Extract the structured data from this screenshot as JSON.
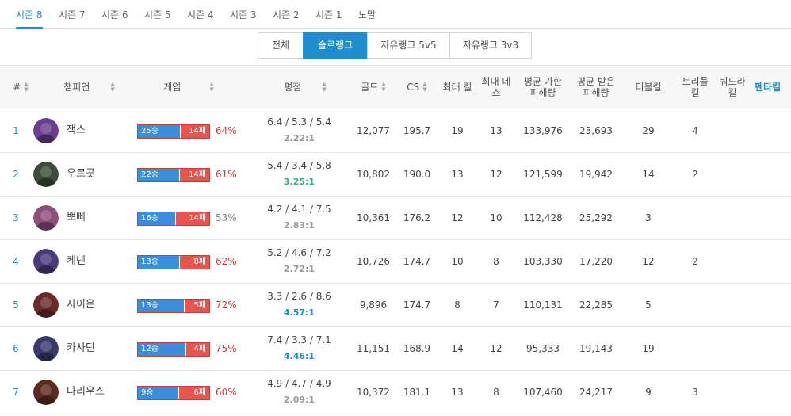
{
  "season_tabs": [
    {
      "label": "시즌 8",
      "active": true
    },
    {
      "label": "시즌 7",
      "active": false
    },
    {
      "label": "시즌 6",
      "active": false
    },
    {
      "label": "시즌 5",
      "active": false
    },
    {
      "label": "시즌 4",
      "active": false
    },
    {
      "label": "시즌 3",
      "active": false
    },
    {
      "label": "시즌 2",
      "active": false
    },
    {
      "label": "시즌 1",
      "active": false
    },
    {
      "label": "노말",
      "active": false
    }
  ],
  "queue_tabs": [
    {
      "label": "전체",
      "active": false
    },
    {
      "label": "솔로랭크",
      "active": true
    },
    {
      "label": "자유랭크 5v5",
      "active": false
    },
    {
      "label": "자유랭크 3v3",
      "active": false
    }
  ],
  "columns": {
    "rank": "#",
    "champion": "챔피언",
    "games": "게임",
    "rating": "평점",
    "gold": "골드",
    "cs": "CS",
    "max_kills": "최대 킬",
    "max_deaths": "최대 데스",
    "dmg_dealt": "평균 가한 피해량",
    "dmg_taken": "평균 받은 피해량",
    "double": "더블킬",
    "triple": "트리플킬",
    "quadra": "쿼드라킬",
    "penta": "펜타킬"
  },
  "colors": {
    "accent": "#1f8ecd",
    "win": "#3b8ed9",
    "loss": "#e8544e",
    "winrate_high": "#d0393a",
    "winrate_mid": "#888888",
    "ratio_normal": "#999999",
    "ratio_good": "#2daf7f",
    "ratio_great": "#1f8ecd"
  },
  "rows": [
    {
      "rank": "1",
      "name": "잭스",
      "icon": "jax-avatar",
      "wins": "25승",
      "losses": "14패",
      "win_frac": 0.641,
      "winrate": "64%",
      "wr_color": "#d0393a",
      "kda": "6.4 / 5.3 / 5.4",
      "ratio": "2.22:1",
      "ratio_color": "#999999",
      "gold": "12,077",
      "cs": "195.7",
      "max_kills": "19",
      "max_deaths": "13",
      "dmg_dealt": "133,976",
      "dmg_taken": "23,693",
      "double": "29",
      "triple": "4",
      "quadra": "",
      "penta": "",
      "avatar_color": "#6a3f8f"
    },
    {
      "rank": "2",
      "name": "우르곳",
      "icon": "urgot-avatar",
      "wins": "22승",
      "losses": "14패",
      "win_frac": 0.611,
      "winrate": "61%",
      "wr_color": "#d0393a",
      "kda": "5.4 / 3.4 / 5.8",
      "ratio": "3.25:1",
      "ratio_color": "#2daf7f",
      "gold": "10,802",
      "cs": "190.0",
      "max_kills": "13",
      "max_deaths": "12",
      "dmg_dealt": "121,599",
      "dmg_taken": "19,942",
      "double": "14",
      "triple": "2",
      "quadra": "",
      "penta": "",
      "avatar_color": "#3e4a3a"
    },
    {
      "rank": "3",
      "name": "뽀삐",
      "icon": "poppy-avatar",
      "wins": "16승",
      "losses": "14패",
      "win_frac": 0.533,
      "winrate": "53%",
      "wr_color": "#888888",
      "kda": "4.2 / 4.1 / 7.5",
      "ratio": "2.83:1",
      "ratio_color": "#999999",
      "gold": "10,361",
      "cs": "176.2",
      "max_kills": "12",
      "max_deaths": "10",
      "dmg_dealt": "112,428",
      "dmg_taken": "25,292",
      "double": "3",
      "triple": "",
      "quadra": "",
      "penta": "",
      "avatar_color": "#8a4f7a"
    },
    {
      "rank": "4",
      "name": "케넨",
      "icon": "kennen-avatar",
      "wins": "13승",
      "losses": "8패",
      "win_frac": 0.619,
      "winrate": "62%",
      "wr_color": "#d0393a",
      "kda": "5.2 / 4.6 / 7.2",
      "ratio": "2.72:1",
      "ratio_color": "#999999",
      "gold": "10,726",
      "cs": "174.7",
      "max_kills": "10",
      "max_deaths": "8",
      "dmg_dealt": "103,330",
      "dmg_taken": "17,220",
      "double": "12",
      "triple": "2",
      "quadra": "",
      "penta": "",
      "avatar_color": "#4a3a7a"
    },
    {
      "rank": "5",
      "name": "사이온",
      "icon": "sion-avatar",
      "wins": "13승",
      "losses": "5패",
      "win_frac": 0.722,
      "winrate": "72%",
      "wr_color": "#d0393a",
      "kda": "3.3 / 2.6 / 8.6",
      "ratio": "4.57:1",
      "ratio_color": "#1f8ecd",
      "gold": "9,896",
      "cs": "174.7",
      "max_kills": "8",
      "max_deaths": "7",
      "dmg_dealt": "110,131",
      "dmg_taken": "22,285",
      "double": "5",
      "triple": "",
      "quadra": "",
      "penta": "",
      "avatar_color": "#6a2a2a"
    },
    {
      "rank": "6",
      "name": "카사딘",
      "icon": "kassadin-avatar",
      "wins": "12승",
      "losses": "4패",
      "win_frac": 0.75,
      "winrate": "75%",
      "wr_color": "#d0393a",
      "kda": "7.4 / 3.3 / 7.1",
      "ratio": "4.46:1",
      "ratio_color": "#1f8ecd",
      "gold": "11,151",
      "cs": "168.9",
      "max_kills": "14",
      "max_deaths": "12",
      "dmg_dealt": "95,333",
      "dmg_taken": "19,143",
      "double": "19",
      "triple": "",
      "quadra": "",
      "penta": "",
      "avatar_color": "#3a3a6a"
    },
    {
      "rank": "7",
      "name": "다리우스",
      "icon": "darius-avatar",
      "wins": "9승",
      "losses": "6패",
      "win_frac": 0.6,
      "winrate": "60%",
      "wr_color": "#d0393a",
      "kda": "4.9 / 4.7 / 4.9",
      "ratio": "2.09:1",
      "ratio_color": "#999999",
      "gold": "10,372",
      "cs": "181.1",
      "max_kills": "13",
      "max_deaths": "8",
      "dmg_dealt": "107,460",
      "dmg_taken": "24,217",
      "double": "9",
      "triple": "3",
      "quadra": "",
      "penta": "",
      "avatar_color": "#5a2a22"
    }
  ]
}
